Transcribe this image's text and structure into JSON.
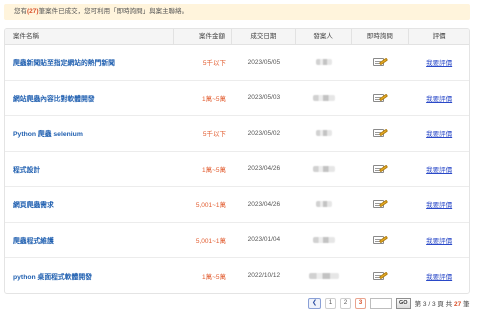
{
  "notice": {
    "prefix": "您有",
    "count": "(27)",
    "suffix": "筆案件已成交，您可利用「即時詢問」與案主聯絡。"
  },
  "table": {
    "headers": {
      "name": "案件名稱",
      "amount": "案件金額",
      "date": "成交日期",
      "client": "發案人",
      "chat": "即時詢問",
      "eval": "評價"
    },
    "rows": [
      {
        "name": "爬蟲新聞貼至指定網站的熱門新聞",
        "amount": "5千以下",
        "date": "2023/05/05",
        "eval": "我要評價"
      },
      {
        "name": "網站爬蟲內容比對軟體開發",
        "amount": "1萬~5萬",
        "date": "2023/05/03",
        "eval": "我要評價"
      },
      {
        "name": "Python 爬蟲 selenium",
        "amount": "5千以下",
        "date": "2023/05/02",
        "eval": "我要評價"
      },
      {
        "name": "程式設計",
        "amount": "1萬~5萬",
        "date": "2023/04/26",
        "eval": "我要評價"
      },
      {
        "name": "網頁爬蟲需求",
        "amount": "5,001~1萬",
        "date": "2023/04/26",
        "eval": "我要評價"
      },
      {
        "name": "爬蟲程式維護",
        "amount": "5,001~1萬",
        "date": "2023/01/04",
        "eval": "我要評價"
      },
      {
        "name": "python 桌面程式軟體開發",
        "amount": "1萬~5萬",
        "date": "2022/10/12",
        "eval": "我要評價"
      }
    ]
  },
  "pagination": {
    "prev_icon": "chevron-left-icon",
    "pages": [
      "1",
      "2",
      "3"
    ],
    "current": "3",
    "go_label": "GO",
    "info_prefix": "第",
    "info_page": "3",
    "info_sep": "/",
    "info_total_pages": "3",
    "info_mid": "頁 共",
    "info_total": "27",
    "info_suffix": "筆"
  },
  "colors": {
    "accent": "#d9502a",
    "link": "#1f5fb0",
    "notice_bg": "#fff4dc"
  }
}
